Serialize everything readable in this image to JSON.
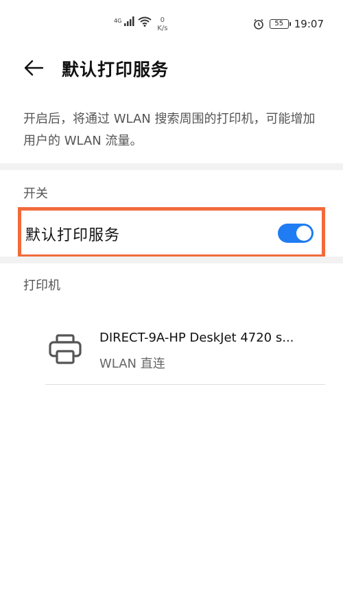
{
  "status_bar": {
    "network": "4G",
    "speed_value": "0",
    "speed_unit": "K/s",
    "battery": "55",
    "time": "19:07"
  },
  "header": {
    "title": "默认打印服务"
  },
  "description": "开启后，将通过 WLAN 搜索周围的打印机，可能增加用户的 WLAN 流量。",
  "switch_section": {
    "label": "开关",
    "row_label": "默认打印服务",
    "enabled": true
  },
  "printer_section": {
    "label": "打印机",
    "printers": [
      {
        "name": "DIRECT-9A-HP DeskJet 4720 s...",
        "type": "WLAN 直连"
      }
    ]
  },
  "colors": {
    "highlight_border": "#f26a3b",
    "toggle_on": "#1f7cf2"
  },
  "icons": [
    "back-arrow-icon",
    "signal-icon",
    "wifi-icon",
    "alarm-icon",
    "battery-icon",
    "printer-icon"
  ]
}
